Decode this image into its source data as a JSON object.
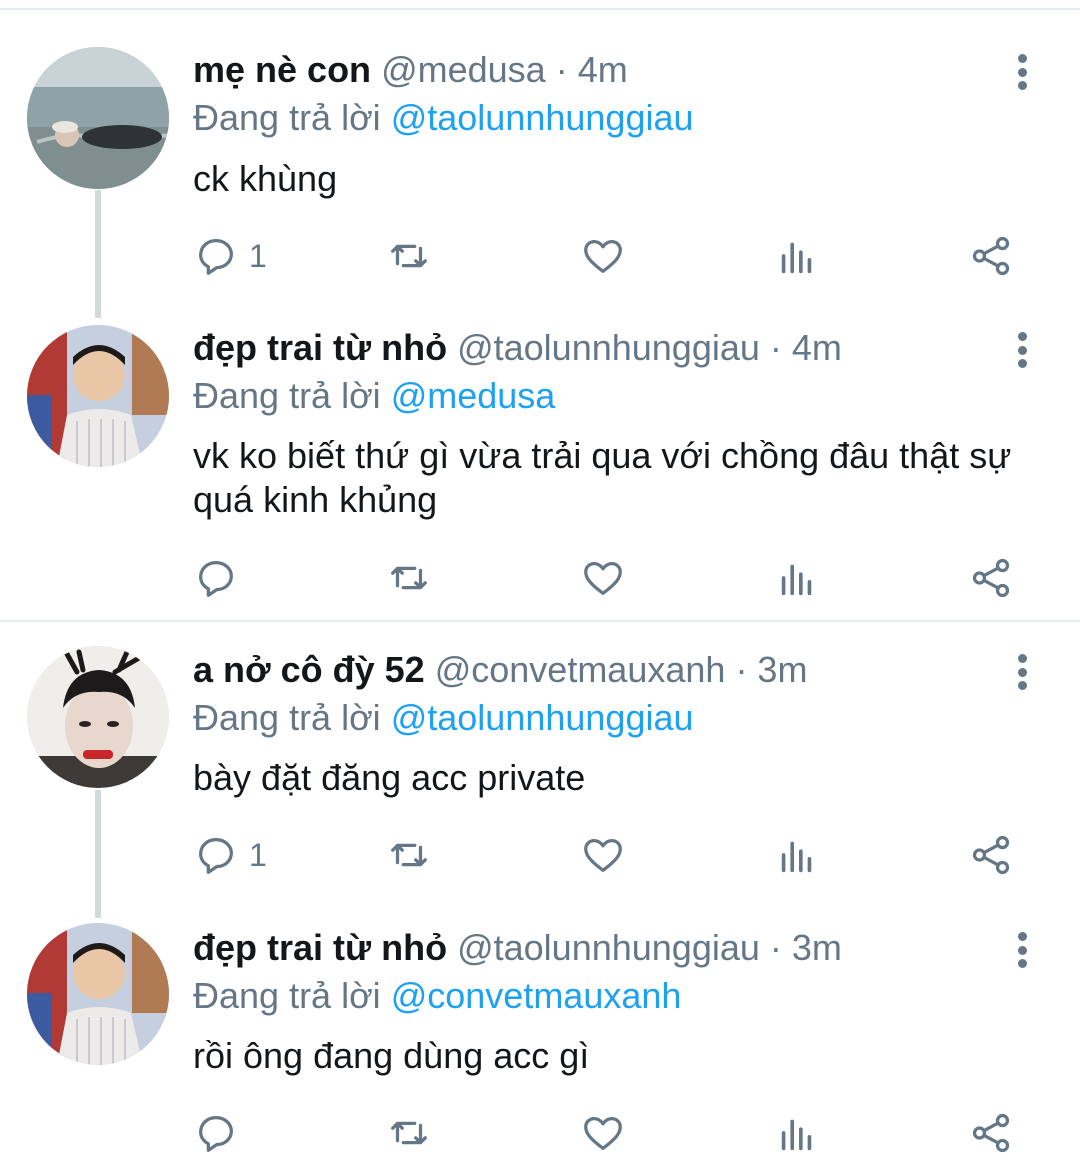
{
  "reply_prefix": "Đang trả lời",
  "tweets": [
    {
      "name": "mẹ nè con",
      "handle": "@medusa",
      "time": "· 4m",
      "reply_to": "@taolunnhunggiau",
      "text": "ck khùng",
      "reply_count": "1"
    },
    {
      "name": "đẹp trai từ nhỏ",
      "handle": "@taolunnhunggiau",
      "time": "· 4m",
      "reply_to": "@medusa",
      "text": "vk ko biết thứ gì vừa trải qua với chồng đâu thật sự quá kinh khủng",
      "reply_count": ""
    },
    {
      "name": "a nở cô đỳ 52",
      "handle": "@convetmauxanh",
      "time": "· 3m",
      "reply_to": "@taolunnhunggiau",
      "text": "bày đặt đăng acc private",
      "reply_count": "1"
    },
    {
      "name": "đẹp trai từ nhỏ",
      "handle": "@taolunnhunggiau",
      "time": "· 3m",
      "reply_to": "@convetmauxanh",
      "text": "rồi ông đang dùng acc gì",
      "reply_count": ""
    }
  ],
  "colors": {
    "name": "#14171a",
    "secondary": "#657786",
    "mention": "#1da1f2",
    "separator": "#e6ecf0"
  },
  "icons": [
    "reply-icon",
    "retweet-icon",
    "like-icon",
    "analytics-icon",
    "share-icon",
    "more-icon"
  ]
}
